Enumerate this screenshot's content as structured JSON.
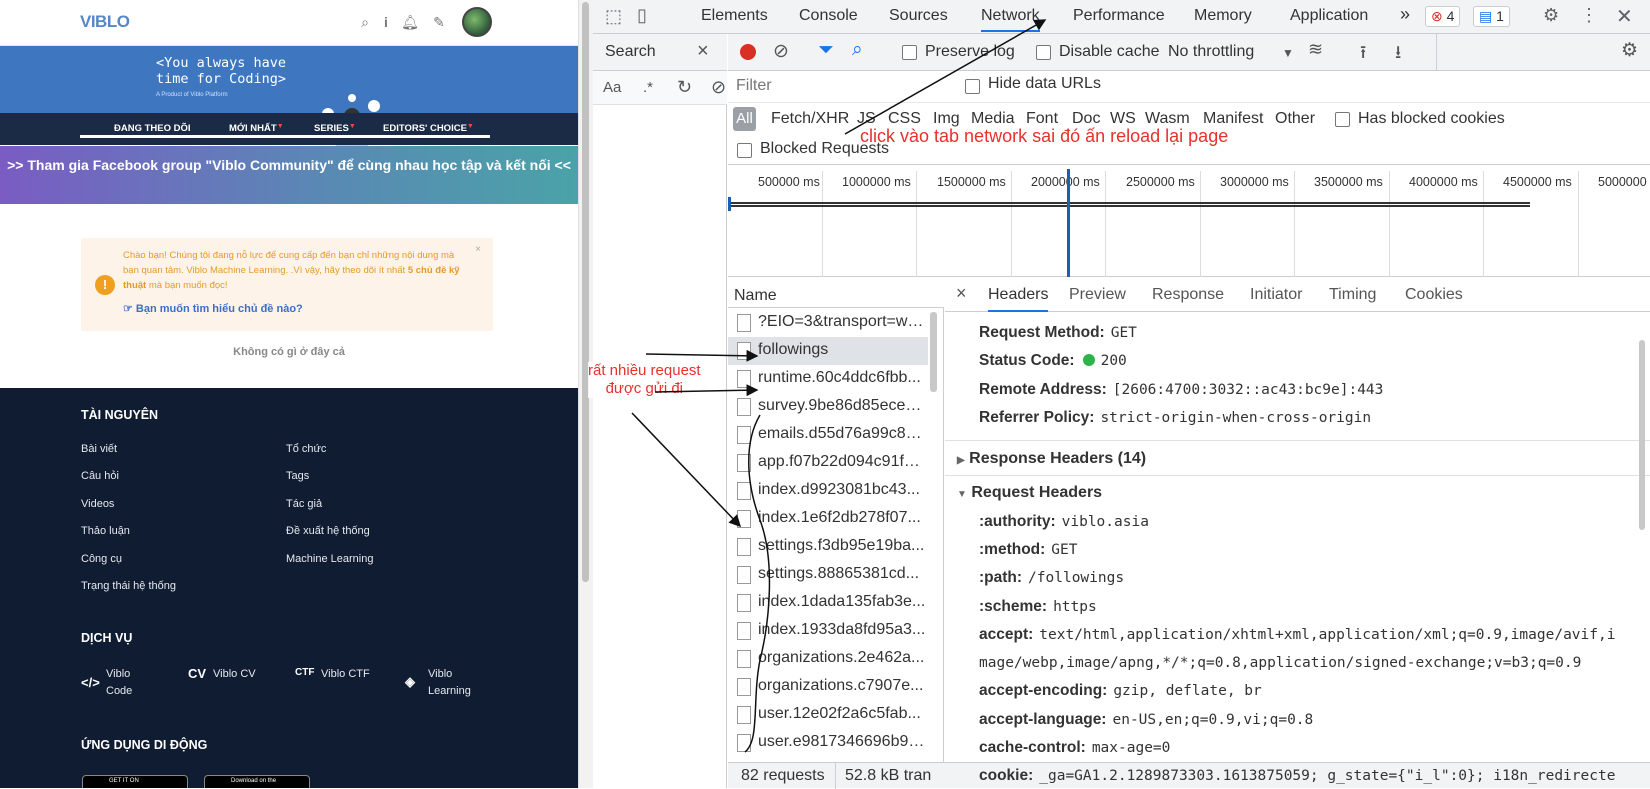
{
  "site": {
    "logo": "VIBLO",
    "banner_text": "<You always have\ntime for Coding>",
    "banner_sub": "A Product of Viblo Platform",
    "nav": [
      "ĐANG THEO DÕI",
      "MỚI NHẤT",
      "SERIES",
      "EDITORS' CHOICE"
    ],
    "fb_banner": ">> Tham gia Facebook group \"Viblo Community\" để cùng nhau học tập và kết nối <<",
    "notice": {
      "text_pre": "Chào bạn! Chúng tôi đang nỗ lực để cung cấp đến bạn chỉ những nội dung mà bạn quan tâm. Viblo Machine Learning. .Vì vậy, hãy theo dõi ít nhất ",
      "text_bold": "5 chủ đề kỹ thuật",
      "text_post": " mà bạn muốn đọc!",
      "link": "Bạn muốn tìm hiểu chủ đề nào?",
      "close": "×"
    },
    "empty": "Không có gì ở đây cả",
    "footer": {
      "resources_title": "TÀI NGUYÊN",
      "resources_col1": [
        "Bài viết",
        "Câu hỏi",
        "Videos",
        "Thảo luận",
        "Công cụ",
        "Trạng thái hệ thống"
      ],
      "resources_col2": [
        "Tổ chức",
        "Tags",
        "Tác giả",
        "Đề xuất hệ thống",
        "Machine Learning"
      ],
      "services_title": "DỊCH VỤ",
      "services": [
        "Viblo\nCode",
        "Viblo CV",
        "Viblo CTF",
        "Viblo\nLearning"
      ],
      "services_icons": [
        "</>",
        "CV",
        "CTF",
        "◈"
      ],
      "mobile_title": "ỨNG DỤNG DI ĐỘNG",
      "store1": "GET IT ON",
      "store2": "Download on the"
    }
  },
  "devtools": {
    "tabs": [
      "Elements",
      "Console",
      "Sources",
      "Network",
      "Performance",
      "Memory",
      "Application"
    ],
    "active_tab": "Network",
    "more": "»",
    "error_count": "4",
    "message_count": "1",
    "search_title": "Search",
    "search_tools": [
      "Aa",
      ".*"
    ],
    "toolbar": {
      "preserve_log": "Preserve log",
      "disable_cache": "Disable cache",
      "throttling": "No throttling"
    },
    "filter_placeholder": "Filter",
    "hide_data_urls": "Hide data URLs",
    "types": [
      "All",
      "Fetch/XHR",
      "JS",
      "CSS",
      "Img",
      "Media",
      "Font",
      "Doc",
      "WS",
      "Wasm",
      "Manifest",
      "Other"
    ],
    "has_blocked_cookies": "Has blocked cookies",
    "blocked_requests": "Blocked Requests",
    "ticks": [
      "500000 ms",
      "1000000 ms",
      "1500000 ms",
      "2000000 ms",
      "2500000 ms",
      "3000000 ms",
      "3500000 ms",
      "4000000 ms",
      "4500000 ms",
      "5000000"
    ],
    "list_header": "Name",
    "requests": [
      "?EIO=3&transport=websocket",
      "followings",
      "runtime.60c4ddc6fbb...",
      "survey.9be86d85eced...",
      "emails.d55d76a99c8e...",
      "app.f07b22d094c91f7...",
      "index.d9923081bc43...",
      "index.1e6f2db278f07...",
      "settings.f3db95e19ba...",
      "settings.88865381cd...",
      "index.1dada135fab3e...",
      "index.1933da8fd95a3...",
      "organizations.2e462a...",
      "organizations.c7907e...",
      "user.12e02f2a6c5fab...",
      "user.e9817346696b93..."
    ],
    "selected_request": "followings",
    "status_requests": "82 requests",
    "status_transfer": "52.8 kB tran",
    "detail_tabs": [
      "Headers",
      "Preview",
      "Response",
      "Initiator",
      "Timing",
      "Cookies"
    ],
    "general": [
      {
        "k": "Request Method:",
        "v": "GET"
      },
      {
        "k": "Status Code:",
        "v": "200"
      },
      {
        "k": "Remote Address:",
        "v": "[2606:4700:3032::ac43:bc9e]:443"
      },
      {
        "k": "Referrer Policy:",
        "v": "strict-origin-when-cross-origin"
      }
    ],
    "response_headers_title": "Response Headers (14)",
    "request_headers_title": "Request Headers",
    "request_headers": [
      {
        "k": ":authority:",
        "v": "viblo.asia"
      },
      {
        "k": ":method:",
        "v": "GET"
      },
      {
        "k": ":path:",
        "v": "/followings"
      },
      {
        "k": ":scheme:",
        "v": "https"
      },
      {
        "k": "accept:",
        "v": "text/html,application/xhtml+xml,application/xml;q=0.9,image/avif,i"
      },
      {
        "k": "",
        "v": "mage/webp,image/apng,*/*;q=0.8,application/signed-exchange;v=b3;q=0.9"
      },
      {
        "k": "accept-encoding:",
        "v": "gzip, deflate, br"
      },
      {
        "k": "accept-language:",
        "v": "en-US,en;q=0.9,vi;q=0.8"
      },
      {
        "k": "cache-control:",
        "v": "max-age=0"
      },
      {
        "k": "cookie:",
        "v": "_ga=GA1.2.1289873303.1613875059; g_state={\"i_l\":0}; i18n_redirecte"
      }
    ]
  },
  "annotations": {
    "network_hint": "click vào tab network sai đó ấn reload lại page",
    "requests_hint": "rất nhiều request\nđược gửi đi"
  },
  "colors": {
    "accent": "#1a73e8",
    "annotation": "#e8302c",
    "footer_bg": "#0f1c31",
    "banner_bg": "#3f76c0"
  }
}
